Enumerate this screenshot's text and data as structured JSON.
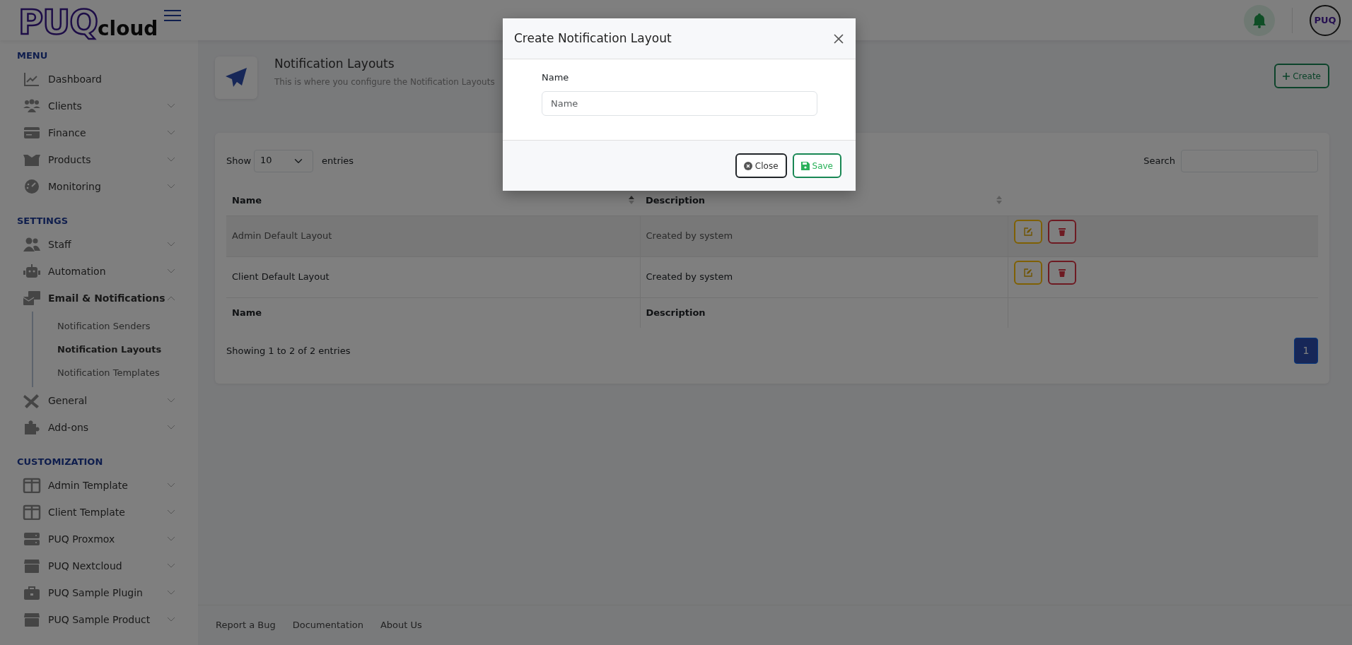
{
  "header": {
    "logo": {
      "mark": "PUQ",
      "suffix": "cloud"
    },
    "avatar": "PUQ"
  },
  "sidebar": {
    "sections": [
      {
        "title": "MENU",
        "items": [
          {
            "label": "Dashboard"
          },
          {
            "label": "Clients",
            "expanded": false
          },
          {
            "label": "Finance",
            "expanded": false
          },
          {
            "label": "Products",
            "expanded": false
          },
          {
            "label": "Monitoring",
            "expanded": false
          }
        ]
      },
      {
        "title": "SETTINGS",
        "items": [
          {
            "label": "Staff",
            "expanded": false
          },
          {
            "label": "Automation",
            "expanded": false
          },
          {
            "label": "Email & Notifications",
            "expanded": true,
            "children": [
              {
                "label": "Notification Senders",
                "selected": false
              },
              {
                "label": "Notification Layouts",
                "selected": true
              },
              {
                "label": "Notification Templates",
                "selected": false
              }
            ]
          },
          {
            "label": "General",
            "expanded": false
          },
          {
            "label": "Add-ons",
            "expanded": false
          }
        ]
      },
      {
        "title": "CUSTOMIZATION",
        "items": [
          {
            "label": "Admin Template",
            "expanded": false
          },
          {
            "label": "Client Template",
            "expanded": false
          },
          {
            "label": "PUQ Proxmox",
            "expanded": false
          },
          {
            "label": "PUQ Nextcloud",
            "expanded": false
          },
          {
            "label": "PUQ Sample Plugin",
            "expanded": false
          },
          {
            "label": "PUQ Sample Product",
            "expanded": false
          }
        ]
      }
    ]
  },
  "page": {
    "title": "Notification Layouts",
    "subtitle": "This is where you configure the Notification Layouts",
    "create_button": "Create"
  },
  "table": {
    "show_label": "Show",
    "page_length": "10",
    "entries_label": "entries",
    "search_label": "Search",
    "columns": [
      {
        "label": "Name",
        "sorted": true
      },
      {
        "label": "Description",
        "sorted": false
      }
    ],
    "rows": [
      {
        "name": "Admin Default Layout",
        "description": "Created by system",
        "highlighted": true
      },
      {
        "name": "Client Default Layout",
        "description": "Created by system",
        "highlighted": false
      }
    ],
    "footer_columns": [
      "Name",
      "Description"
    ],
    "info": "Showing 1 to 2 of 2 entries",
    "pages": [
      {
        "label": "1",
        "selected": true
      }
    ]
  },
  "footer": {
    "links": [
      "Report a Bug",
      "Documentation",
      "About Us"
    ]
  },
  "modal": {
    "title": "Create Notification Layout",
    "field_label": "Name",
    "placeholder": "Name",
    "buttons": [
      {
        "kind": "close",
        "label": "Close"
      },
      {
        "kind": "save",
        "label": "Save"
      }
    ]
  }
}
